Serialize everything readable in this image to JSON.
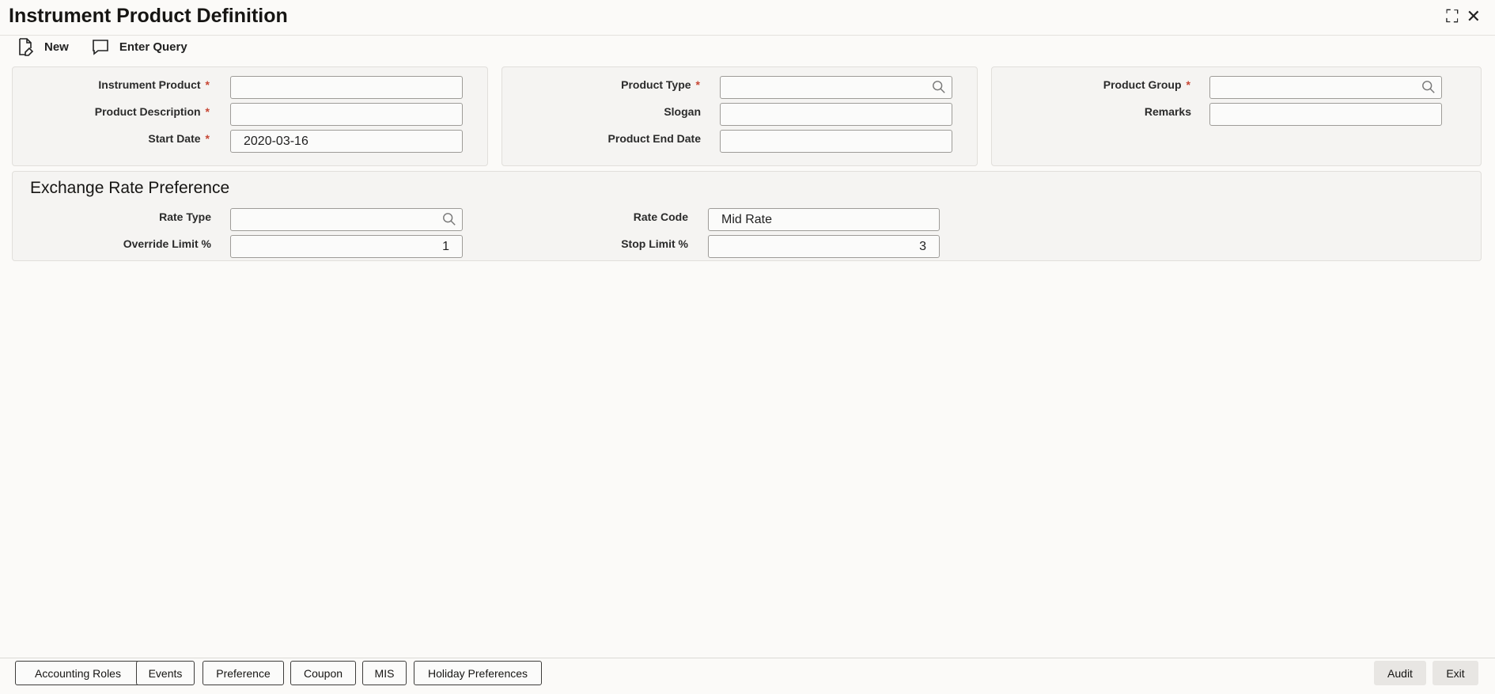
{
  "window": {
    "title": "Instrument Product Definition",
    "minimize_glyph": "⛶",
    "close_glyph": "✕"
  },
  "toolbar": {
    "new_label": "New",
    "enter_query_label": "Enter Query"
  },
  "main": {
    "instrument_product": {
      "label": "Instrument Product",
      "value": ""
    },
    "product_description": {
      "label": "Product Description",
      "value": ""
    },
    "start_date": {
      "label": "Start Date",
      "value": "2020-03-16"
    },
    "product_type": {
      "label": "Product Type",
      "value": ""
    },
    "slogan": {
      "label": "Slogan",
      "value": ""
    },
    "product_end_date": {
      "label": "Product End Date",
      "value": ""
    },
    "product_group": {
      "label": "Product Group",
      "value": ""
    },
    "remarks": {
      "label": "Remarks",
      "value": ""
    },
    "required_marker": "*"
  },
  "exchange": {
    "title": "Exchange Rate Preference",
    "rate_type": {
      "label": "Rate Type",
      "value": ""
    },
    "rate_code": {
      "label": "Rate Code",
      "value": "Mid Rate"
    },
    "override_limit": {
      "label": "Override Limit %",
      "value": "1"
    },
    "stop_limit": {
      "label": "Stop Limit %",
      "value": "3"
    }
  },
  "footer": {
    "buttons": [
      "Accounting Roles",
      "Events",
      "Preference",
      "Coupon",
      "MIS",
      "Holiday Preferences"
    ],
    "audit_label": "Audit",
    "exit_label": "Exit"
  },
  "colors": {
    "required": "#c74634",
    "panel_bg": "#f5f4f2"
  },
  "icons": {
    "new": "new-document-icon",
    "enter_query": "chat-bubble-icon",
    "lookup": "search-icon"
  }
}
